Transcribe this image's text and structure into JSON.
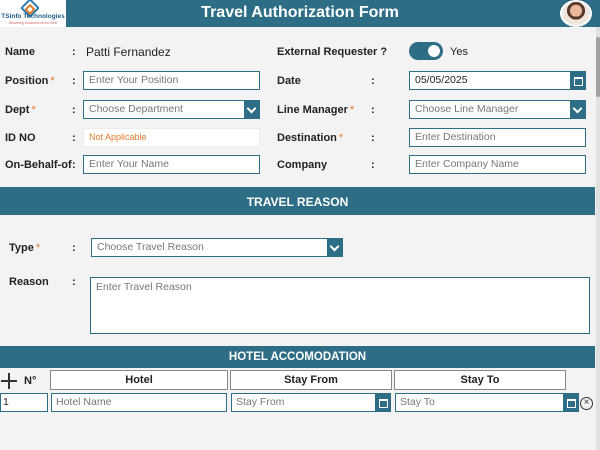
{
  "header": {
    "logo_name": "TSinfo Technologies",
    "logo_tagline": "Delivering Business at the Best",
    "title": "Travel Authorization Form"
  },
  "fields": {
    "name": {
      "label": "Name",
      "value": "Patti Fernandez"
    },
    "position": {
      "label": "Position",
      "placeholder": "Enter Your Position"
    },
    "dept": {
      "label": "Dept",
      "placeholder": "Choose Department"
    },
    "id_no": {
      "label": "ID NO",
      "value": "Not Applicable"
    },
    "on_behalf_of": {
      "label": "On-Behalf-of",
      "placeholder": "Enter Your Name"
    },
    "external_requester": {
      "label": "External Requester ?",
      "value": "Yes",
      "checked": true
    },
    "date": {
      "label": "Date",
      "value": "05/05/2025"
    },
    "line_manager": {
      "label": "Line Manager",
      "placeholder": "Choose Line Manager"
    },
    "destination": {
      "label": "Destination",
      "placeholder": "Enter Destination"
    },
    "company": {
      "label": "Company",
      "placeholder": "Enter Company Name"
    },
    "required_mark": "*",
    "colon": ":"
  },
  "travel_reason": {
    "section_title": "TRAVEL REASON",
    "type": {
      "label": "Type",
      "placeholder": "Choose Travel Reason"
    },
    "reason": {
      "label": "Reason",
      "placeholder": "Enter Travel Reason"
    }
  },
  "hotel": {
    "section_title": "HOTEL ACCOMODATION",
    "columns": [
      "N°",
      "Hotel",
      "Stay From",
      "Stay To"
    ],
    "rows": [
      {
        "num": "1",
        "hotel_placeholder": "Hotel Name",
        "from_placeholder": "Stay From",
        "to_placeholder": "Stay To"
      }
    ]
  },
  "icons": {
    "add_row": "plus-icon",
    "remove_row": "close-circle-icon",
    "calendar": "calendar-icon",
    "dropdown": "chevron-down-icon"
  },
  "colors": {
    "primary": "#2d6e86",
    "required": "#e07a2b",
    "background": "#f3f3f3"
  }
}
